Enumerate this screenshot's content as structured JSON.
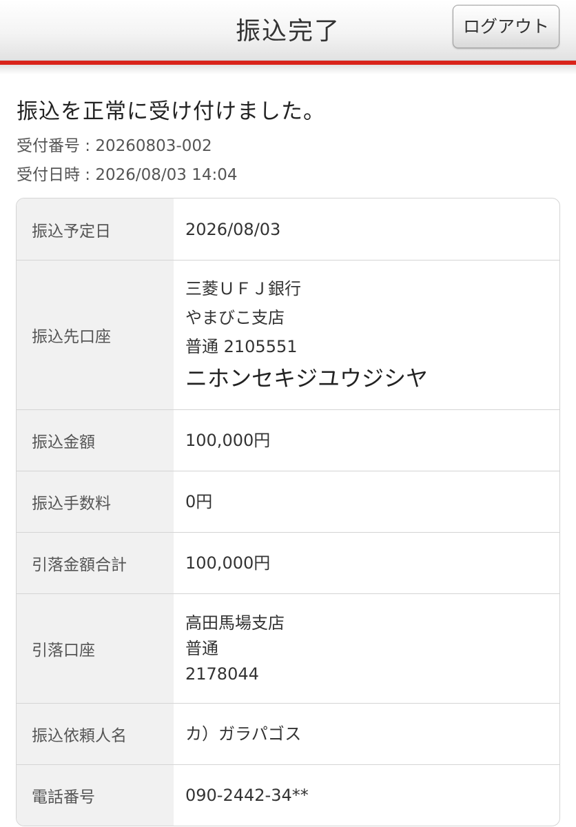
{
  "header": {
    "title": "振込完了",
    "logout_label": "ログアウト"
  },
  "completion": {
    "message": "振込を正常に受け付けました。",
    "receipt_number": "受付番号 : 20260803-002",
    "receipt_datetime": "受付日時 : 2026/08/03 14:04"
  },
  "details": {
    "transfer_date": {
      "label": "振込予定日",
      "value": "2026/08/03"
    },
    "payee_account": {
      "label": "振込先口座",
      "bank": "三菱ＵＦＪ銀行",
      "branch": "やまびこ支店",
      "account": "普通 2105551",
      "holder": "ニホンセキジユウジシヤ"
    },
    "amount": {
      "label": "振込金額",
      "value": "100,000円"
    },
    "fee": {
      "label": "振込手数料",
      "value": "0円"
    },
    "total": {
      "label": "引落金額合計",
      "value": "100,000円"
    },
    "debit_account": {
      "label": "引落口座",
      "branch": "高田馬場支店",
      "type": "普通",
      "number": "2178044"
    },
    "requester": {
      "label": "振込依頼人名",
      "value": "カ）ガラパゴス"
    },
    "phone": {
      "label": "電話番号",
      "value": "090-2442-34**"
    }
  },
  "colors": {
    "accent_red": "#d9231a",
    "label_bg": "#f1f1f1",
    "border": "#d4d4d4"
  }
}
